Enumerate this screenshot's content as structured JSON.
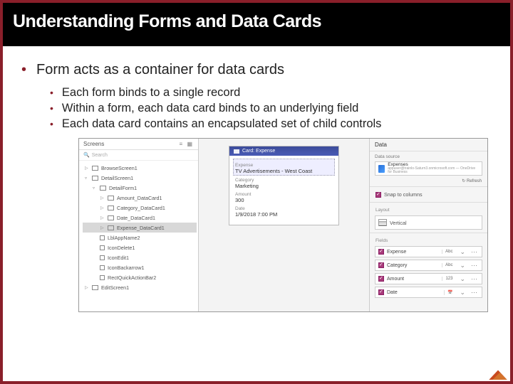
{
  "title": "Understanding Forms and Data Cards",
  "bullets": {
    "main": "Form acts as a container for data cards",
    "subs": [
      "Each form binds to a single record",
      "Within a form, each data card binds to an underlying field",
      "Each data card contains an encapsulated set of child controls"
    ]
  },
  "screens_panel": {
    "heading": "Screens",
    "search_placeholder": "Search"
  },
  "tree": [
    {
      "indent": 0,
      "tri": "▷",
      "label": "BrowseScreen1"
    },
    {
      "indent": 0,
      "tri": "▿",
      "label": "DetailScreen1"
    },
    {
      "indent": 1,
      "tri": "▿",
      "label": "DetailForm1"
    },
    {
      "indent": 2,
      "tri": "▷",
      "label": "Amount_DataCard1"
    },
    {
      "indent": 2,
      "tri": "▷",
      "label": "Category_DataCard1"
    },
    {
      "indent": 2,
      "tri": "▷",
      "label": "Date_DataCard1"
    },
    {
      "indent": 2,
      "tri": "▷",
      "label": "Expense_DataCard1",
      "sel": true
    },
    {
      "indent": 1,
      "tri": "",
      "label": "LblAppName2",
      "ico": "sq"
    },
    {
      "indent": 1,
      "tri": "",
      "label": "IconDelete1",
      "ico": "sq"
    },
    {
      "indent": 1,
      "tri": "",
      "label": "IconEdit1",
      "ico": "sq"
    },
    {
      "indent": 1,
      "tri": "",
      "label": "IconBackarrow1",
      "ico": "sq"
    },
    {
      "indent": 1,
      "tri": "",
      "label": "RectQuickActionBar2",
      "ico": "sq"
    },
    {
      "indent": 0,
      "tri": "▷",
      "label": "EditScreen1"
    }
  ],
  "card": {
    "header": "Card: Expense",
    "fields": [
      {
        "label": "Expense",
        "value": "TV Advertisements - West Coast",
        "sel": true
      },
      {
        "label": "Category",
        "value": "Marketing"
      },
      {
        "label": "Amount",
        "value": "300"
      },
      {
        "label": "Date",
        "value": "1/9/2018 7:00 PM"
      }
    ]
  },
  "data_panel": {
    "heading": "Data",
    "ds_label": "Data source",
    "ds_name": "Expenses",
    "ds_sub": "appuser@trainlo-Saturn3.onmicrosoft.com — OneDrive for Business",
    "refresh": "↻ Refresh",
    "snap_label": "Snap to columns",
    "layout_heading": "Layout",
    "layout_value": "Vertical",
    "fields_heading": "Fields",
    "fields": [
      {
        "name": "Expense",
        "type": "Abc"
      },
      {
        "name": "Category",
        "type": "Abc"
      },
      {
        "name": "Amount",
        "type": "123"
      },
      {
        "name": "Date",
        "type": "📅"
      }
    ]
  }
}
